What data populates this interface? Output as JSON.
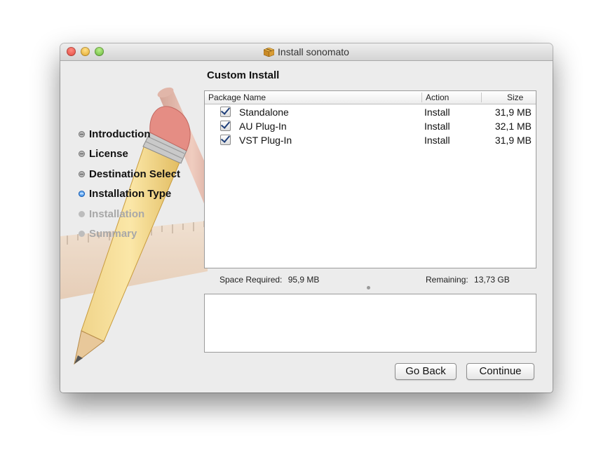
{
  "window": {
    "title": "Install sonomato",
    "title_icon": "package-icon"
  },
  "sidebar": {
    "steps": [
      {
        "label": "Introduction",
        "state": "done"
      },
      {
        "label": "License",
        "state": "done"
      },
      {
        "label": "Destination Select",
        "state": "done"
      },
      {
        "label": "Installation Type",
        "state": "current"
      },
      {
        "label": "Installation",
        "state": "future"
      },
      {
        "label": "Summary",
        "state": "future"
      }
    ]
  },
  "panel": {
    "title": "Custom Install",
    "table": {
      "headers": {
        "name": "Package Name",
        "action": "Action",
        "size": "Size"
      },
      "rows": [
        {
          "checked": true,
          "name": "Standalone",
          "action": "Install",
          "size": "31,9 MB"
        },
        {
          "checked": true,
          "name": "AU Plug-In",
          "action": "Install",
          "size": "32,1 MB"
        },
        {
          "checked": true,
          "name": "VST Plug-In",
          "action": "Install",
          "size": "31,9 MB"
        }
      ]
    },
    "space_required_label": "Space Required:",
    "space_required_value": "95,9 MB",
    "remaining_label": "Remaining:",
    "remaining_value": "13,73 GB",
    "description": ""
  },
  "buttons": {
    "back": "Go Back",
    "continue": "Continue"
  }
}
